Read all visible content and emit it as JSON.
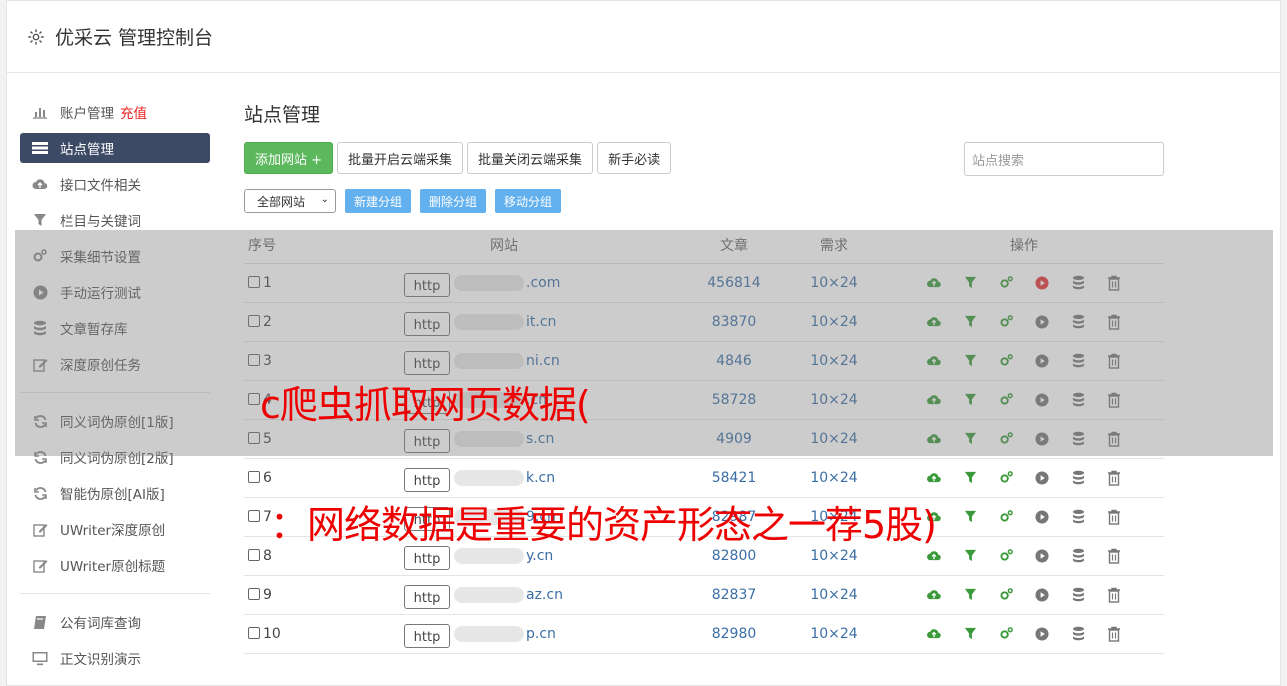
{
  "app": {
    "title": "优采云 管理控制台"
  },
  "sidebar": {
    "groups": [
      [
        {
          "label": "账户管理",
          "badge": "充值",
          "icon": "bar-chart-icon"
        },
        {
          "label": "站点管理",
          "icon": "list-icon",
          "active": true
        },
        {
          "label": "接口文件相关",
          "icon": "cloud-upload-icon"
        },
        {
          "label": "栏目与关键词",
          "icon": "filter-icon"
        },
        {
          "label": "采集细节设置",
          "icon": "gears-icon"
        },
        {
          "label": "手动运行测试",
          "icon": "play-icon"
        },
        {
          "label": "文章暂存库",
          "icon": "database-icon"
        },
        {
          "label": "深度原创任务",
          "icon": "edit-icon"
        }
      ],
      [
        {
          "label": "同义词伪原创[1版]",
          "icon": "refresh-icon"
        },
        {
          "label": "同义词伪原创[2版]",
          "icon": "refresh-icon"
        },
        {
          "label": "智能伪原创[AI版]",
          "icon": "refresh-icon"
        },
        {
          "label": "UWriter深度原创",
          "icon": "edit-icon"
        },
        {
          "label": "UWriter原创标题",
          "icon": "edit-icon"
        }
      ],
      [
        {
          "label": "公有词库查询",
          "icon": "book-icon"
        },
        {
          "label": "正文识别演示",
          "icon": "monitor-icon"
        }
      ]
    ]
  },
  "main": {
    "title": "站点管理",
    "toolbar": {
      "add_label": "添加网站 +",
      "batch_open_label": "批量开启云端采集",
      "batch_close_label": "批量关闭云端采集",
      "guide_label": "新手必读",
      "search_placeholder": "站点搜索"
    },
    "group_select": "全部网站",
    "group_buttons": {
      "new": "新建分组",
      "delete": "删除分组",
      "move": "移动分组"
    },
    "table": {
      "headers": {
        "no": "序号",
        "site": "网站",
        "articles": "文章",
        "demand": "需求",
        "ops": "操作"
      },
      "rows": [
        {
          "no": "1",
          "proto": "http",
          "site": ".com",
          "articles": "456814",
          "demand": "10×24",
          "run_active": true
        },
        {
          "no": "2",
          "proto": "http",
          "site": "it.cn",
          "articles": "83870",
          "demand": "10×24"
        },
        {
          "no": "3",
          "proto": "http",
          "site": "ni.cn",
          "articles": "4846",
          "demand": "10×24"
        },
        {
          "no": "4",
          "proto": "http",
          "site": ".cn",
          "articles": "58728",
          "demand": "10×24"
        },
        {
          "no": "5",
          "proto": "http",
          "site": "s.cn",
          "articles": "4909",
          "demand": "10×24"
        },
        {
          "no": "6",
          "proto": "http",
          "site": "k.cn",
          "articles": "58421",
          "demand": "10×24"
        },
        {
          "no": "7",
          "proto": "http",
          "site": "9.cn",
          "articles": "82987",
          "demand": "10×24"
        },
        {
          "no": "8",
          "proto": "http",
          "site": "y.cn",
          "articles": "82800",
          "demand": "10×24"
        },
        {
          "no": "9",
          "proto": "http",
          "site": "az.cn",
          "articles": "82837",
          "demand": "10×24"
        },
        {
          "no": "10",
          "proto": "http",
          "site": "p.cn",
          "articles": "82980",
          "demand": "10×24"
        }
      ]
    }
  },
  "overlay": {
    "caption1": "c爬虫抓取网页数据(",
    "caption2": "：网络数据是重要的资产形态之一荐5股)"
  },
  "colors": {
    "accent": "#3c4a66",
    "green": "#5cb85c",
    "link": "#3a6ea5",
    "caption": "#ee0000"
  }
}
